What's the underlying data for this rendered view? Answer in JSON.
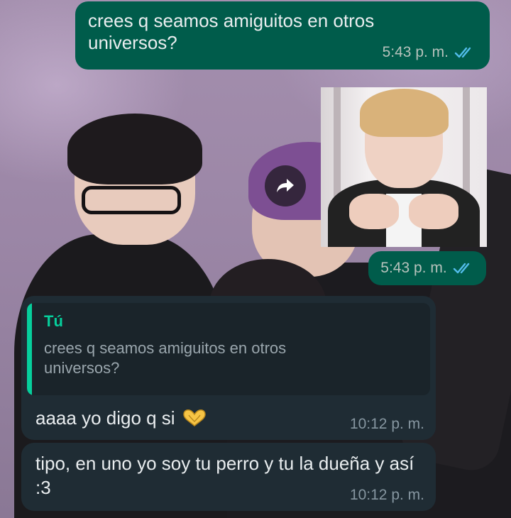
{
  "chat": {
    "messages": [
      {
        "direction": "outgoing",
        "text": "crees q seamos amiguitos en otros universos?",
        "time": "5:43 p. m.",
        "status": "read"
      },
      {
        "direction": "outgoing",
        "type": "image",
        "forwarded": true,
        "time": "5:43 p. m.",
        "status": "read"
      },
      {
        "direction": "incoming",
        "reply_to": {
          "author": "Tú",
          "text": "crees q seamos amiguitos en otros universos?"
        },
        "text": "aaaa yo digo q si",
        "emoji_icon": "heart-hands-icon",
        "time": "10:12 p. m."
      },
      {
        "direction": "incoming",
        "text": "tipo, en uno yo soy tu perro y tu la dueña y así :3",
        "time": "10:12 p. m."
      }
    ]
  },
  "colors": {
    "outgoing_bubble": "#005c4b",
    "incoming_bubble": "#1f2c34",
    "quote_accent": "#06cf9c",
    "read_ticks": "#53bdeb"
  },
  "icons": {
    "forward": "forward-arrow-icon",
    "read": "double-check-icon"
  }
}
